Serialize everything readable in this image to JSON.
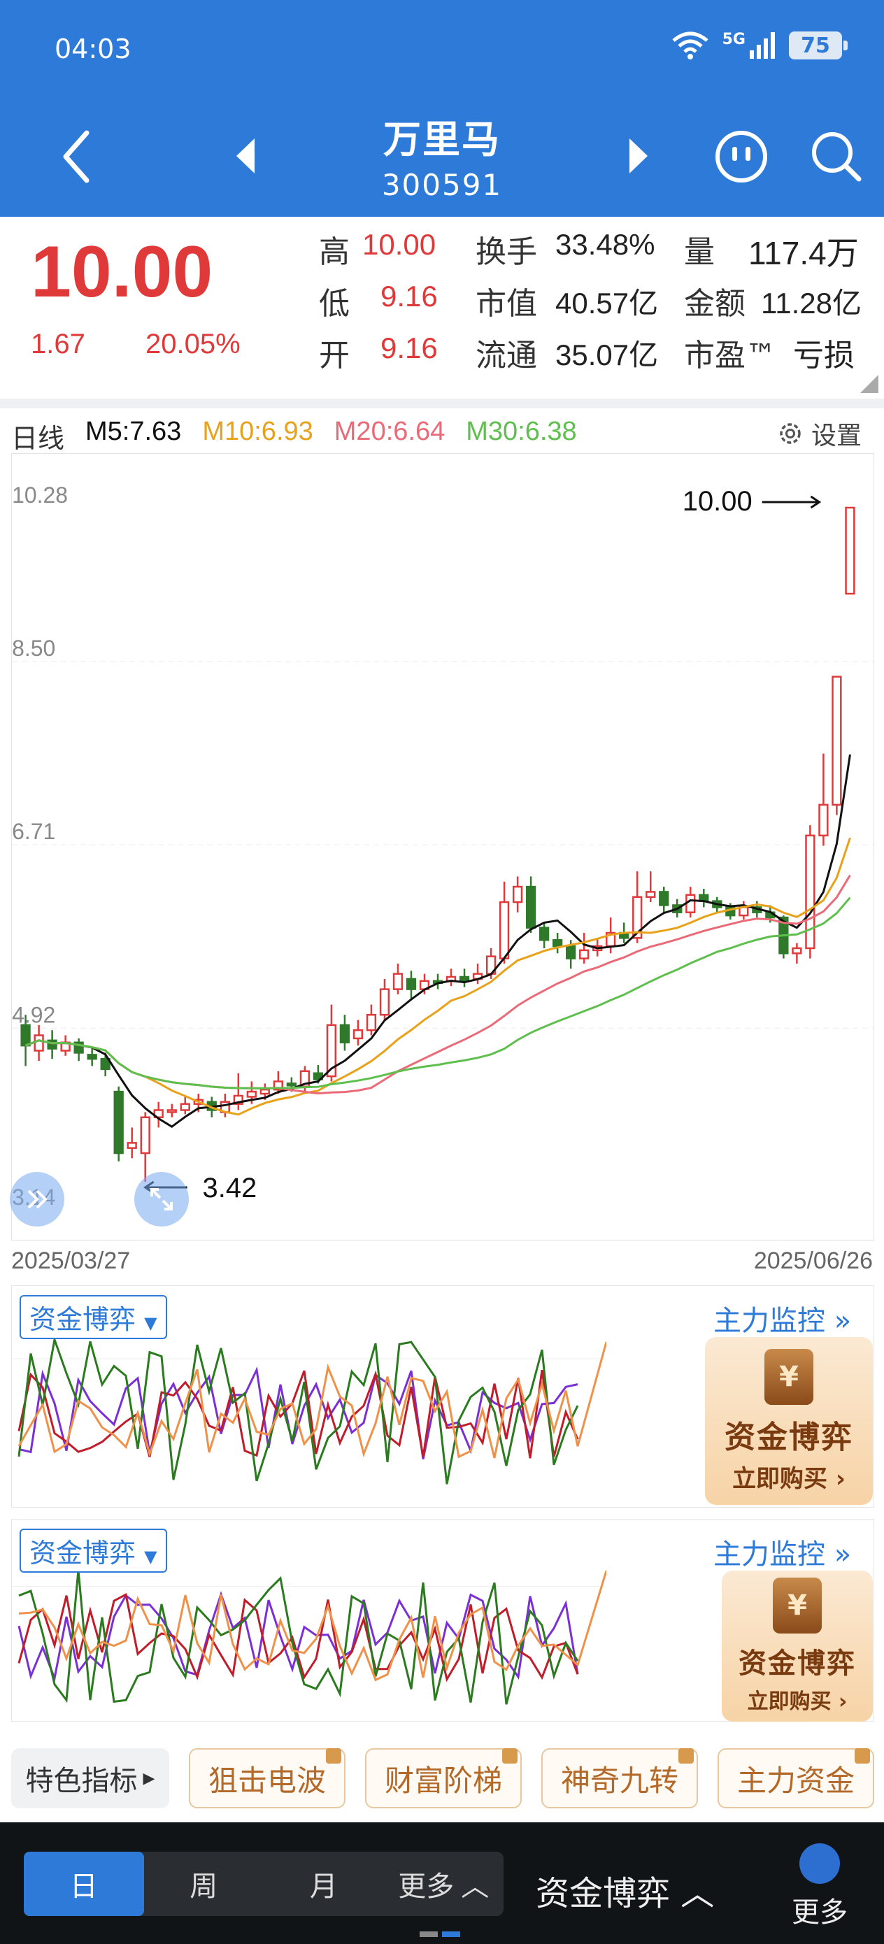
{
  "status": {
    "time": "04:03",
    "network": "5G",
    "battery": "75"
  },
  "header": {
    "name": "万里马",
    "code": "300591"
  },
  "quote": {
    "price": "10.00",
    "change": "1.67",
    "change_pct": "20.05%",
    "high_label": "高",
    "high": "10.00",
    "low_label": "低",
    "low": "9.16",
    "open_label": "开",
    "open": "9.16",
    "turnover_label": "换手",
    "turnover": "33.48%",
    "mktcap_label": "市值",
    "mktcap": "40.57亿",
    "float_label": "流通",
    "float": "35.07亿",
    "volume_label": "量",
    "volume": "117.4万",
    "amount_label": "金额",
    "amount": "11.28亿",
    "pe_label": "市盈™",
    "pe": "亏损"
  },
  "chart_legend": {
    "period": "日线",
    "m5": "M5:7.63",
    "m10": "M10:6.93",
    "m20": "M20:6.64",
    "m30": "M30:6.38",
    "settings": "设置"
  },
  "colors": {
    "up": "#e0393a",
    "down": "#2f7a2a",
    "m5": "#111111",
    "m10": "#e8a21a",
    "m20": "#ea6a78",
    "m30": "#5fbf4e",
    "accent": "#2d7ad8"
  },
  "chart_data": {
    "type": "candlestick",
    "y_ticks": [
      "10.28",
      "8.50",
      "6.71",
      "4.92",
      "3.14"
    ],
    "ylim": [
      3.14,
      10.28
    ],
    "x_start": "2025/03/27",
    "x_end": "2025/06/26",
    "max_label": "10.00",
    "min_label": "3.42",
    "candles": [
      [
        4.95,
        4.75,
        5.05,
        4.55
      ],
      [
        4.7,
        4.85,
        4.95,
        4.6
      ],
      [
        4.8,
        4.72,
        4.9,
        4.62
      ],
      [
        4.7,
        4.78,
        4.85,
        4.65
      ],
      [
        4.78,
        4.68,
        4.82,
        4.6
      ],
      [
        4.66,
        4.62,
        4.72,
        4.55
      ],
      [
        4.62,
        4.52,
        4.68,
        4.45
      ],
      [
        4.3,
        3.7,
        4.35,
        3.62
      ],
      [
        3.75,
        3.8,
        3.95,
        3.65
      ],
      [
        3.7,
        4.05,
        4.1,
        3.42
      ],
      [
        4.05,
        4.12,
        4.2,
        3.95
      ],
      [
        4.1,
        4.12,
        4.18,
        4.05
      ],
      [
        4.12,
        4.18,
        4.25,
        4.08
      ],
      [
        4.18,
        4.22,
        4.28,
        4.1
      ],
      [
        4.2,
        4.12,
        4.25,
        4.05
      ],
      [
        4.1,
        4.2,
        4.28,
        4.05
      ],
      [
        4.18,
        4.26,
        4.48,
        4.12
      ],
      [
        4.25,
        4.3,
        4.4,
        4.18
      ],
      [
        4.28,
        4.32,
        4.38,
        4.22
      ],
      [
        4.32,
        4.4,
        4.5,
        4.28
      ],
      [
        4.38,
        4.36,
        4.44,
        4.3
      ],
      [
        4.35,
        4.5,
        4.55,
        4.3
      ],
      [
        4.48,
        4.42,
        4.56,
        4.38
      ],
      [
        4.45,
        4.95,
        5.15,
        4.4
      ],
      [
        4.95,
        4.78,
        5.05,
        4.7
      ],
      [
        4.82,
        4.9,
        5.0,
        4.75
      ],
      [
        4.9,
        5.05,
        5.15,
        4.85
      ],
      [
        5.05,
        5.3,
        5.4,
        5.0
      ],
      [
        5.3,
        5.45,
        5.55,
        5.25
      ],
      [
        5.4,
        5.3,
        5.48,
        5.2
      ],
      [
        5.3,
        5.38,
        5.45,
        5.25
      ],
      [
        5.38,
        5.36,
        5.45,
        5.3
      ],
      [
        5.38,
        5.42,
        5.5,
        5.33
      ],
      [
        5.42,
        5.38,
        5.5,
        5.32
      ],
      [
        5.4,
        5.45,
        5.55,
        5.35
      ],
      [
        5.45,
        5.62,
        5.7,
        5.4
      ],
      [
        5.6,
        6.15,
        6.35,
        5.55
      ],
      [
        6.15,
        6.3,
        6.4,
        6.05
      ],
      [
        6.3,
        5.9,
        6.4,
        5.85
      ],
      [
        5.9,
        5.78,
        5.95,
        5.7
      ],
      [
        5.78,
        5.72,
        5.85,
        5.65
      ],
      [
        5.72,
        5.6,
        5.78,
        5.5
      ],
      [
        5.6,
        5.68,
        5.85,
        5.55
      ],
      [
        5.68,
        5.72,
        5.8,
        5.62
      ],
      [
        5.72,
        5.85,
        6.0,
        5.65
      ],
      [
        5.85,
        5.8,
        5.95,
        5.75
      ],
      [
        5.8,
        6.2,
        6.45,
        5.75
      ],
      [
        6.2,
        6.25,
        6.45,
        6.15
      ],
      [
        6.25,
        6.12,
        6.3,
        6.05
      ],
      [
        6.12,
        6.05,
        6.18,
        6.0
      ],
      [
        6.05,
        6.22,
        6.3,
        6.0
      ],
      [
        6.22,
        6.16,
        6.28,
        6.1
      ],
      [
        6.16,
        6.1,
        6.2,
        6.05
      ],
      [
        6.1,
        6.02,
        6.14,
        5.98
      ],
      [
        6.02,
        6.1,
        6.16,
        5.98
      ],
      [
        6.1,
        6.05,
        6.16,
        6.0
      ],
      [
        6.05,
        6.0,
        6.12,
        5.95
      ],
      [
        6.0,
        5.65,
        6.02,
        5.6
      ],
      [
        5.65,
        5.7,
        5.75,
        5.55
      ],
      [
        5.7,
        6.8,
        6.9,
        5.6
      ],
      [
        6.8,
        7.1,
        7.6,
        6.7
      ],
      [
        7.1,
        8.35,
        8.35,
        7.0
      ],
      [
        9.16,
        10.0,
        10.0,
        9.16
      ]
    ]
  },
  "panels": [
    {
      "dropdown": "资金博弈",
      "link": "主力监控",
      "promo_t1": "资金博弈",
      "promo_t2": "立即购买"
    },
    {
      "dropdown": "资金博弈",
      "link": "主力监控",
      "promo_t1": "资金博弈",
      "promo_t2": "立即购买"
    }
  ],
  "features": {
    "main": "特色指标",
    "items": [
      "狙击电波",
      "财富阶梯",
      "神奇九转",
      "主力资金"
    ]
  },
  "bottom": {
    "periods": [
      "日",
      "周",
      "月",
      "更多"
    ],
    "indicator": "资金博弈",
    "more": "更多"
  }
}
